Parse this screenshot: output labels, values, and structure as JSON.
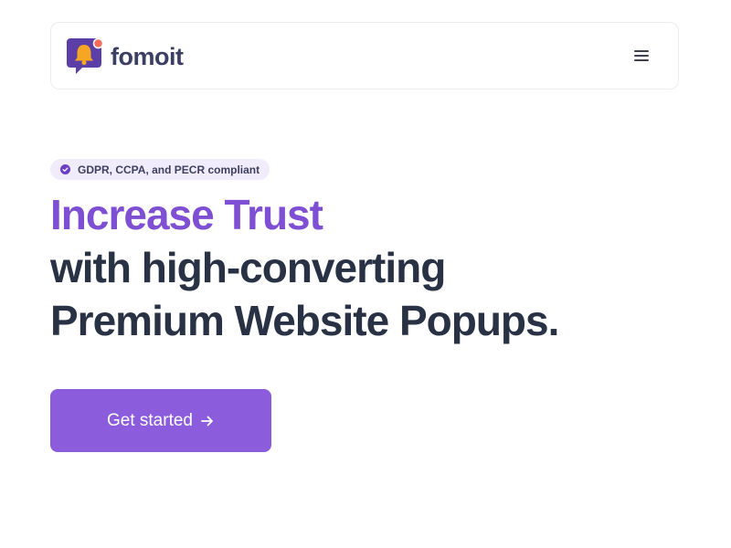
{
  "header": {
    "brand_name": "fomoit",
    "logo_icon": "bell-speech-bubble-icon",
    "menu_icon": "hamburger-menu-icon"
  },
  "hero": {
    "badge": {
      "icon": "check-badge-icon",
      "text": "GDPR, CCPA, and PECR compliant"
    },
    "headline_accent": "Increase Trust",
    "headline_line2": "with high-converting",
    "headline_line3": "Premium Website Popups.",
    "cta_label": "Get started",
    "cta_icon": "arrow-right-icon"
  },
  "colors": {
    "accent": "#7f4fd3",
    "button": "#8b5cdc",
    "text_dark": "#283244",
    "badge_bg": "#f1ecfb",
    "logo_orange": "#f5a623",
    "logo_dot": "#f26b5b"
  }
}
